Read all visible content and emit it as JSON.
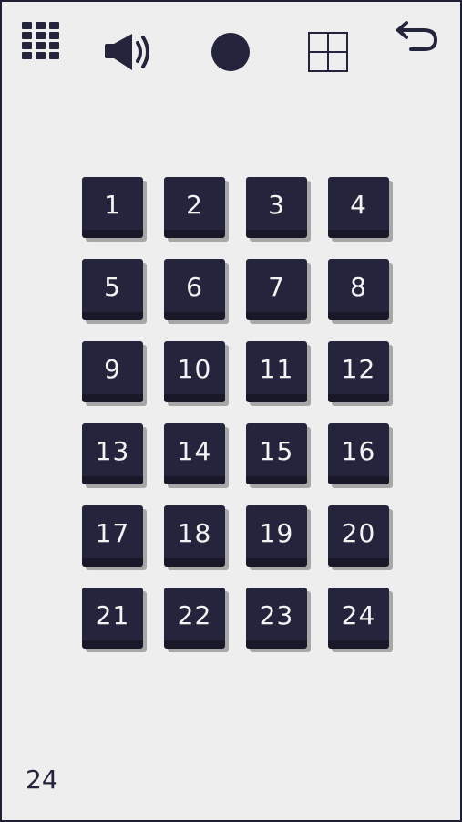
{
  "toolbar": {
    "icons": [
      "levels-grid-icon",
      "speaker-icon",
      "record-dot-icon",
      "grid-view-icon",
      "back-arrow-icon"
    ]
  },
  "colors": {
    "background": "#eeeeee",
    "tile": "#24253d",
    "tile_edge": "#181829",
    "tile_text": "#f3f3f3"
  },
  "levels": [
    "1",
    "2",
    "3",
    "4",
    "5",
    "6",
    "7",
    "8",
    "9",
    "10",
    "11",
    "12",
    "13",
    "14",
    "15",
    "16",
    "17",
    "18",
    "19",
    "20",
    "21",
    "22",
    "23",
    "24"
  ],
  "footer": {
    "count": "24"
  }
}
